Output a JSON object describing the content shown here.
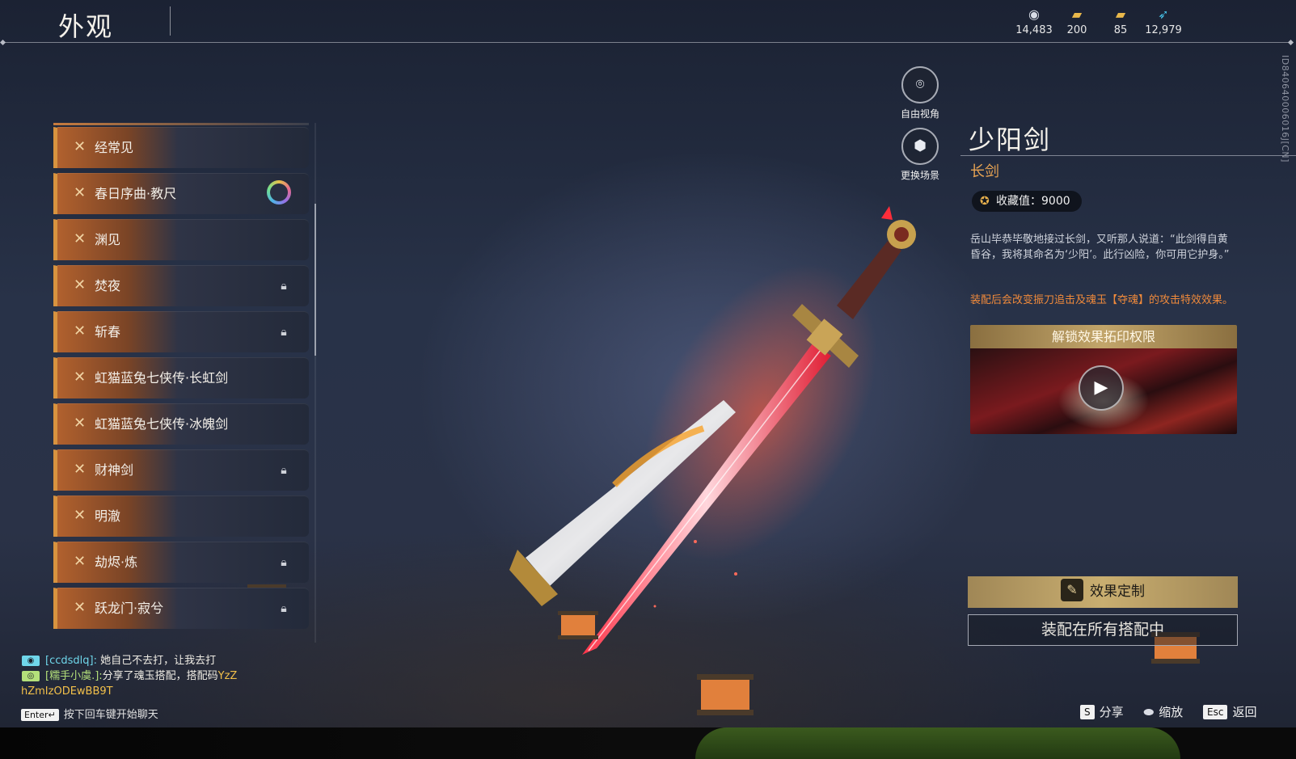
{
  "header": {
    "title": "外观",
    "currencies": [
      {
        "icon": "coin-stack-icon",
        "value": "14,483"
      },
      {
        "icon": "gold-bar-icon",
        "value": "200"
      },
      {
        "icon": "gold-bar-plus-icon",
        "value": "85"
      },
      {
        "icon": "feather-icon",
        "value": "12,979"
      }
    ]
  },
  "side_id": "ID840640006016J[CN]",
  "skin_list": [
    {
      "label": "经常见",
      "locked": false,
      "equipped": false
    },
    {
      "label": "春日序曲·教尺",
      "locked": false,
      "equipped": true
    },
    {
      "label": "渊见",
      "locked": false,
      "equipped": false
    },
    {
      "label": "焚夜",
      "locked": true,
      "equipped": false
    },
    {
      "label": "斩春",
      "locked": true,
      "equipped": false
    },
    {
      "label": "虹猫蓝兔七侠传·长虹剑",
      "locked": false,
      "equipped": false
    },
    {
      "label": "虹猫蓝兔七侠传·冰魄剑",
      "locked": false,
      "equipped": false
    },
    {
      "label": "财神剑",
      "locked": true,
      "equipped": false
    },
    {
      "label": "明澈",
      "locked": false,
      "equipped": false
    },
    {
      "label": "劫烬·炼",
      "locked": true,
      "equipped": false
    },
    {
      "label": "跃龙门·寂兮",
      "locked": true,
      "equipped": false
    }
  ],
  "camera": {
    "free_view": {
      "label": "自由视角",
      "icon": "camera-icon"
    },
    "change_scene": {
      "label": "更换场景",
      "icon": "cube-icon"
    }
  },
  "detail": {
    "name": "少阳剑",
    "type": "长剑",
    "collect_label": "收藏值：9000",
    "description": "岳山毕恭毕敬地接过长剑，又听那人说道：“此剑得自黄昏谷，我将其命名为‘少阳’。此行凶险，你可用它护身。”",
    "effect_note": "装配后会改变振刀追击及魂玉【夺魂】的攻击特效效果。",
    "unlock_title": "解锁效果拓印权限",
    "customize_label": "效果定制",
    "equip_label": "装配在所有搭配中"
  },
  "chat": {
    "messages": [
      {
        "channel_icon": "team-icon",
        "name": "[ccdsdlq]:",
        "text": " 她自己不去打，让我去打"
      },
      {
        "channel_icon": "world-icon",
        "name": "[糯手小虞.]:",
        "text": "分享了魂玉搭配，搭配码",
        "code": "YzZ"
      }
    ],
    "code_continuation": "hZmIzODEwBB9T",
    "enter_key": "Enter↵",
    "enter_hint": "按下回车键开始聊天"
  },
  "hints": {
    "share_key": "S",
    "share_label": "分享",
    "zoom_label": "缩放",
    "back_key": "Esc",
    "back_label": "返回"
  },
  "colors": {
    "accent_orange": "#d8933f",
    "effect_text": "#f08a3b",
    "type_text": "#e7a353",
    "gold_button": "#c9ae70"
  }
}
